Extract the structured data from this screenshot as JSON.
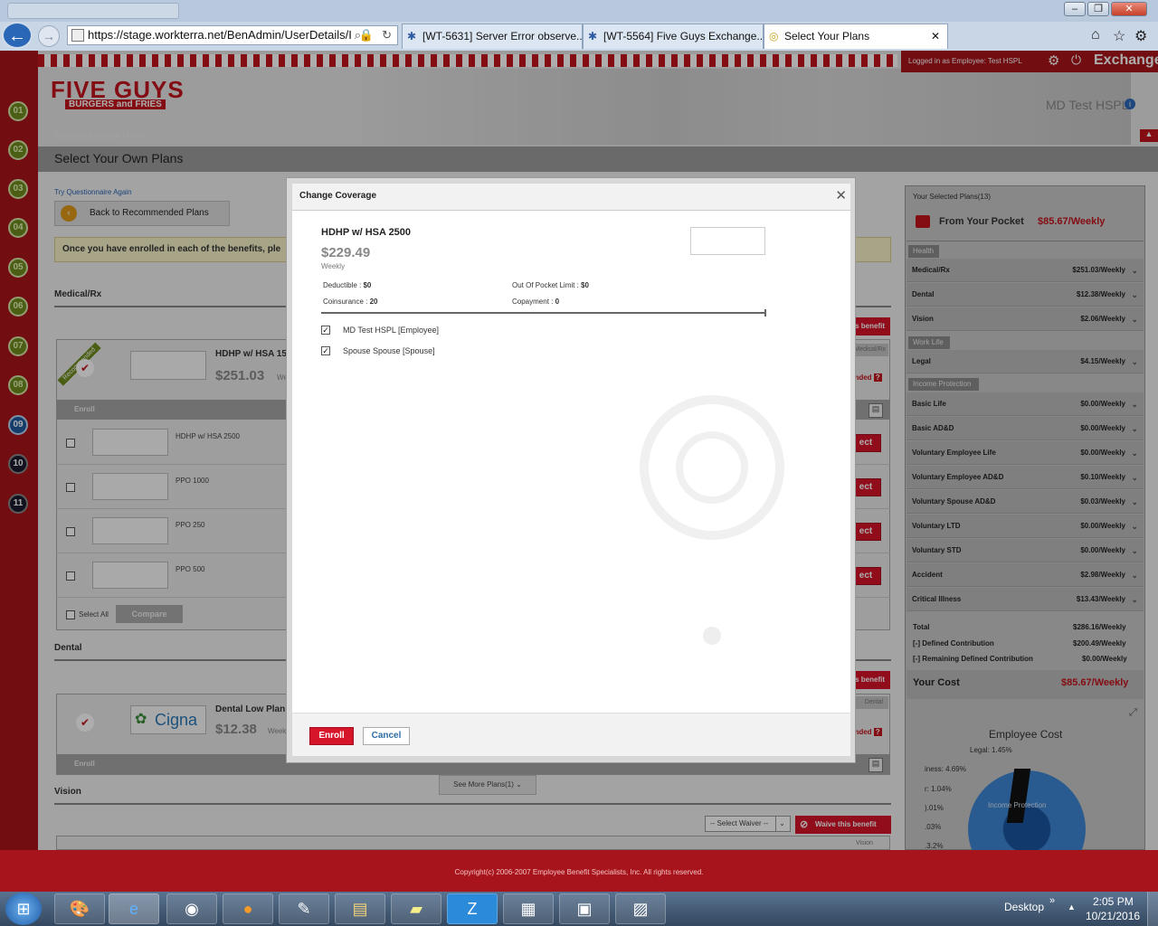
{
  "browser": {
    "address": "https://stage.workterra.net/BenAdmin/UserDetails/I",
    "tabs": [
      {
        "label": "[WT-5631] Server Error observe..."
      },
      {
        "label": "[WT-5564] Five Guys Exchange..."
      },
      {
        "label": "Select Your Plans"
      }
    ],
    "close_glyph": "✕"
  },
  "header": {
    "logged_in": "Logged in as Employee: Test HSPL",
    "exchange": "Exchange",
    "logo_main": "FIVE GUYS",
    "logo_sub": "BURGERS and FRIES",
    "user_name": "MD Test HSPL",
    "breadcrumb": "Exchange Employee Home",
    "page_title": "Select Your Own Plans"
  },
  "steps": [
    "01",
    "02",
    "03",
    "04",
    "05",
    "06",
    "07",
    "08",
    "09",
    "10",
    "11"
  ],
  "page": {
    "try_questionnaire": "Try Questionnaire Again",
    "back_button": "Back to Recommended Plans",
    "enroll_notice": "Once you have enrolled in each of the benefits, ple",
    "medical_section": "Medical/Rx",
    "medical_card_title": "HDHP w/ HSA 15",
    "medical_card_price": "$251.03",
    "medical_card_price_sub": "Wee",
    "enroll_label": "Enroll",
    "plans": [
      "HDHP w/ HSA 2500",
      "PPO 1000",
      "PPO 250",
      "PPO 500"
    ],
    "select_all": "Select All",
    "compare": "Compare",
    "dental_section": "Dental",
    "dental_title": "Dental Low Plan",
    "dental_price": "$12.38",
    "dental_price_sub": "Weekly",
    "cigna": "Cigna",
    "see_more": "See More Plans(1)",
    "vision_section": "Vision",
    "select_waiver": "-- Select Waiver --",
    "waive": "Waive this benefit",
    "right_frag_benefit": "s benefit",
    "right_frag_medical": "Medical/Rx",
    "right_frag_ended": "ended",
    "right_frag_ect": "ect",
    "right_frag_dental": "Dental",
    "right_frag_vision": "Vision",
    "recommended": "Recommended"
  },
  "modal": {
    "title": "Change Coverage",
    "plan_name": "HDHP w/ HSA 2500",
    "price": "$229.49",
    "price_freq": "Weekly",
    "deductible_label": "Deductible :",
    "deductible": "$0",
    "oop_label": "Out Of Pocket Limit :",
    "oop": "$0",
    "coinsurance_label": "Coinsurance :",
    "coinsurance": "20",
    "copayment_label": "Copayment :",
    "copayment": "0",
    "members": [
      {
        "name": "MD Test HSPL [Employee]",
        "checked": true
      },
      {
        "name": "Spouse Spouse [Spouse]",
        "checked": true
      }
    ],
    "enroll_button": "Enroll",
    "cancel_button": "Cancel"
  },
  "summary": {
    "title": "Your Selected Plans(13)",
    "from_pocket_label": "From Your Pocket",
    "from_pocket": "$85.67/Weekly",
    "sections": {
      "health": "Health",
      "work_life": "Work Life",
      "income": "Income Protection"
    },
    "health": [
      {
        "name": "Medical/Rx",
        "value": "$251.03/Weekly"
      },
      {
        "name": "Dental",
        "value": "$12.38/Weekly"
      },
      {
        "name": "Vision",
        "value": "$2.06/Weekly"
      }
    ],
    "work_life": [
      {
        "name": "Legal",
        "value": "$4.15/Weekly"
      }
    ],
    "income": [
      {
        "name": "Basic Life",
        "value": "$0.00/Weekly"
      },
      {
        "name": "Basic AD&D",
        "value": "$0.00/Weekly"
      },
      {
        "name": "Voluntary Employee Life",
        "value": "$0.00/Weekly"
      },
      {
        "name": "Voluntary Employee AD&D",
        "value": "$0.10/Weekly"
      },
      {
        "name": "Voluntary Spouse AD&D",
        "value": "$0.03/Weekly"
      },
      {
        "name": "Voluntary LTD",
        "value": "$0.00/Weekly"
      },
      {
        "name": "Voluntary STD",
        "value": "$0.00/Weekly"
      },
      {
        "name": "Accident",
        "value": "$2.98/Weekly"
      },
      {
        "name": "Critical Illness",
        "value": "$13.43/Weekly"
      }
    ],
    "total_label": "Total",
    "total": "$286.16/Weekly",
    "defined_label": "[-] Defined Contribution",
    "defined": "$200.49/Weekly",
    "remaining_label": "[-] Remaining Defined Contribution",
    "remaining": "$0.00/Weekly",
    "your_cost_label": "Your Cost",
    "your_cost": "$85.67/Weekly",
    "chart_title": "Employee Cost",
    "chart_labels": [
      "Legal: 1.45%",
      "iness: 4.69%",
      "r: 1.04%",
      ").01%",
      ".03%",
      ".3.2%"
    ],
    "chart_inner": "Income Protection"
  },
  "footer": {
    "copyright": "Copyright(c) 2006-2007 Employee Benefit Specialists, Inc. All rights reserved."
  },
  "taskbar": {
    "desktop": "Desktop",
    "time": "2:05 PM",
    "date": "10/21/2016"
  }
}
